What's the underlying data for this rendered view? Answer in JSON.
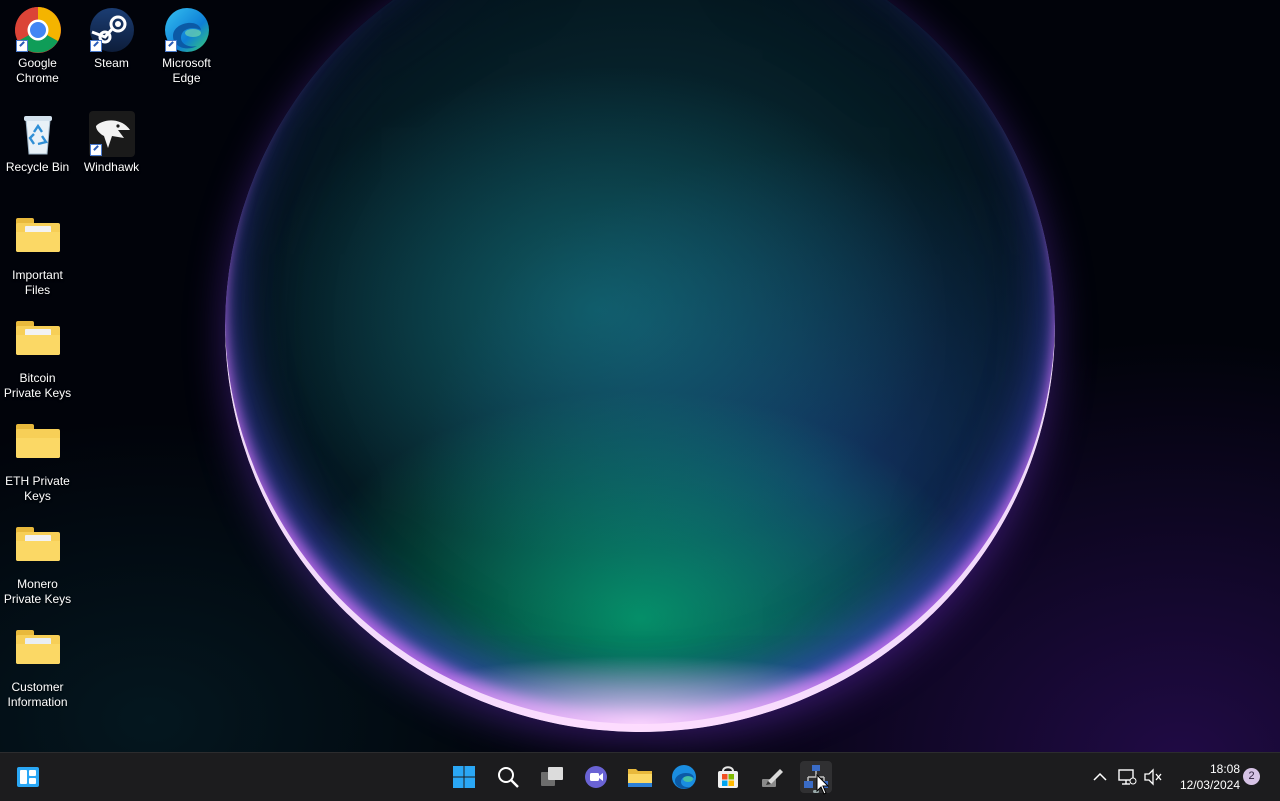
{
  "desktop": {
    "icons": [
      {
        "label": "Google Chrome",
        "icon": "chrome-icon",
        "shortcut": true
      },
      {
        "label": "Steam",
        "icon": "steam-icon",
        "shortcut": true
      },
      {
        "label": "Microsoft Edge",
        "icon": "edge-icon",
        "shortcut": true
      },
      {
        "label": "Recycle Bin",
        "icon": "recycle-bin-icon",
        "shortcut": false
      },
      {
        "label": "Windhawk",
        "icon": "windhawk-icon",
        "shortcut": true
      },
      {
        "label": "Important Files",
        "icon": "folder-icon"
      },
      {
        "label": "Bitcoin Private Keys",
        "icon": "folder-icon"
      },
      {
        "label": "ETH Private Keys",
        "icon": "folder-icon"
      },
      {
        "label": "Monero Private Keys",
        "icon": "folder-icon"
      },
      {
        "label": "Customer Information",
        "icon": "folder-icon"
      }
    ]
  },
  "taskbar": {
    "left_widget_icon": "widgets-icon",
    "apps": [
      {
        "name": "start-button",
        "icon": "windows-logo-icon"
      },
      {
        "name": "search-button",
        "icon": "search-icon"
      },
      {
        "name": "task-view-button",
        "icon": "task-view-icon"
      },
      {
        "name": "teams-chat-button",
        "icon": "teams-chat-icon"
      },
      {
        "name": "file-explorer-button",
        "icon": "folder-icon"
      },
      {
        "name": "edge-button",
        "icon": "edge-icon"
      },
      {
        "name": "store-button",
        "icon": "store-icon"
      },
      {
        "name": "pen-app-button",
        "icon": "pen-icon"
      },
      {
        "name": "network-app-button",
        "icon": "network-icon",
        "active": true
      }
    ],
    "tray": {
      "chevron_icon": "chevron-up-icon",
      "network_icon": "network-disconnected-icon",
      "volume_icon": "volume-muted-icon",
      "time": "18:08",
      "date": "12/03/2024",
      "notification_count": "2"
    }
  },
  "colors": {
    "taskbar_bg": "#1c1c1e",
    "folder_yellow": "#f7cf57",
    "windows_blue": "#2aa7f5",
    "notification_badge": "#d6c3e6"
  }
}
